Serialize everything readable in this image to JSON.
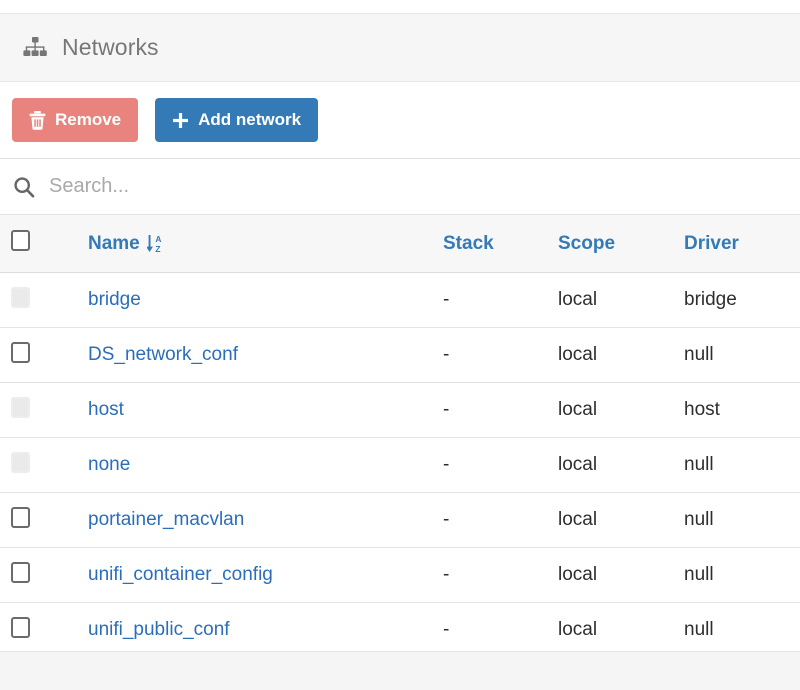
{
  "header": {
    "title": "Networks",
    "icon": "sitemap-icon"
  },
  "toolbar": {
    "remove_label": "Remove",
    "remove_icon": "trash-icon",
    "remove_color": "#e8837d",
    "add_label": "Add network",
    "add_icon": "plus-icon",
    "add_color": "#337ab7"
  },
  "search": {
    "icon": "search-icon",
    "placeholder": "Search...",
    "value": ""
  },
  "table": {
    "columns": [
      {
        "key": "name",
        "label": "Name",
        "sorted": true,
        "sort_icon": "sort-alpha-down-icon"
      },
      {
        "key": "stack",
        "label": "Stack"
      },
      {
        "key": "scope",
        "label": "Scope"
      },
      {
        "key": "driver",
        "label": "Driver"
      }
    ],
    "header_checkbox": {
      "checked": false,
      "disabled": false
    },
    "rows": [
      {
        "name": "bridge",
        "stack": "-",
        "scope": "local",
        "driver": "bridge",
        "checkbox_disabled": true
      },
      {
        "name": "DS_network_conf",
        "stack": "-",
        "scope": "local",
        "driver": "null",
        "checkbox_disabled": false
      },
      {
        "name": "host",
        "stack": "-",
        "scope": "local",
        "driver": "host",
        "checkbox_disabled": true
      },
      {
        "name": "none",
        "stack": "-",
        "scope": "local",
        "driver": "null",
        "checkbox_disabled": true
      },
      {
        "name": "portainer_macvlan",
        "stack": "-",
        "scope": "local",
        "driver": "null",
        "checkbox_disabled": false
      },
      {
        "name": "unifi_container_config",
        "stack": "-",
        "scope": "local",
        "driver": "null",
        "checkbox_disabled": false
      },
      {
        "name": "unifi_public_conf",
        "stack": "-",
        "scope": "local",
        "driver": "null",
        "checkbox_disabled": false
      }
    ]
  },
  "colors": {
    "link": "#2a6ebb",
    "column_header": "#337ab7",
    "header_band": "#f6f6f6",
    "footer": "#f5f5f5"
  }
}
